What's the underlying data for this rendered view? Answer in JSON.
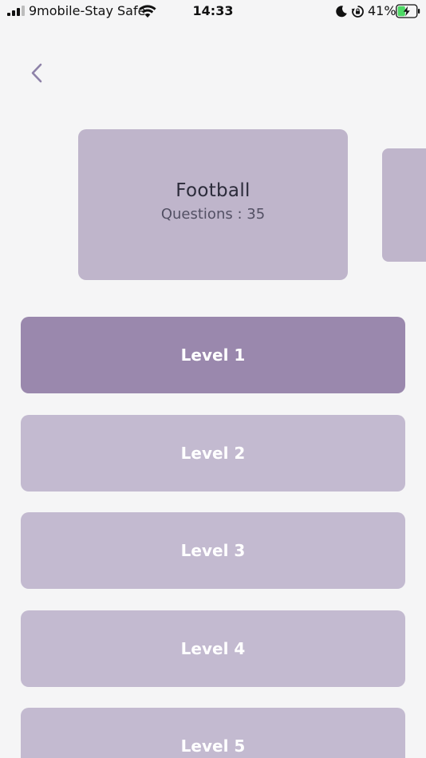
{
  "status_bar": {
    "carrier": "9mobile-Stay Safe",
    "time": "14:33",
    "battery_percent": "41%",
    "battery_level": 0.41
  },
  "category": {
    "title": "Football",
    "questions_label": "Questions : 35"
  },
  "levels": [
    {
      "label": "Level 1",
      "active": true
    },
    {
      "label": "Level 2",
      "active": false
    },
    {
      "label": "Level 3",
      "active": false
    },
    {
      "label": "Level 4",
      "active": false
    },
    {
      "label": "Level 5",
      "active": false
    }
  ],
  "colors": {
    "background": "#f5f5f6",
    "card": "#bfb5cb",
    "level_active": "#9a88ad",
    "level_inactive": "#c3bad0",
    "back_icon": "#8e82a8",
    "battery_fill": "#4cd964"
  },
  "icons": {
    "back": "chevron-left-icon",
    "wifi": "wifi-icon",
    "moon": "moon-icon",
    "rotation_lock": "rotation-lock-icon",
    "battery": "battery-charging-icon",
    "signal": "cellular-signal-icon"
  }
}
